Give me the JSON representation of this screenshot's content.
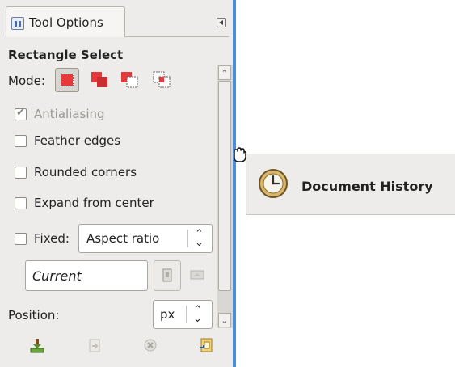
{
  "tab": {
    "title": "Tool Options",
    "icon": "tool-options-icon",
    "menu_icon": "tab-menu-icon"
  },
  "tool": {
    "title": "Rectangle Select",
    "mode_label": "Mode:",
    "modes": [
      {
        "name": "replace",
        "active": true
      },
      {
        "name": "add",
        "active": false
      },
      {
        "name": "subtract",
        "active": false
      },
      {
        "name": "intersect",
        "active": false
      }
    ]
  },
  "options": {
    "antialiasing": {
      "label": "Antialiasing",
      "checked": true,
      "enabled": false
    },
    "feather_edges": {
      "label": "Feather edges",
      "checked": false
    },
    "rounded_corners": {
      "label": "Rounded corners",
      "checked": false
    },
    "expand_from_center": {
      "label": "Expand from center",
      "checked": false
    },
    "fixed": {
      "label": "Fixed:",
      "checked": false,
      "value": "Aspect ratio"
    },
    "current": "Current",
    "position": {
      "label": "Position:",
      "unit": "px"
    }
  },
  "bottom_icons": [
    "save-options-icon",
    "restore-options-icon",
    "delete-options-icon",
    "reset-options-icon"
  ],
  "popup": {
    "label": "Document History",
    "icon": "clock-icon"
  },
  "colors": {
    "accent": "#4a90d9",
    "selection_red": "#e8383a"
  }
}
